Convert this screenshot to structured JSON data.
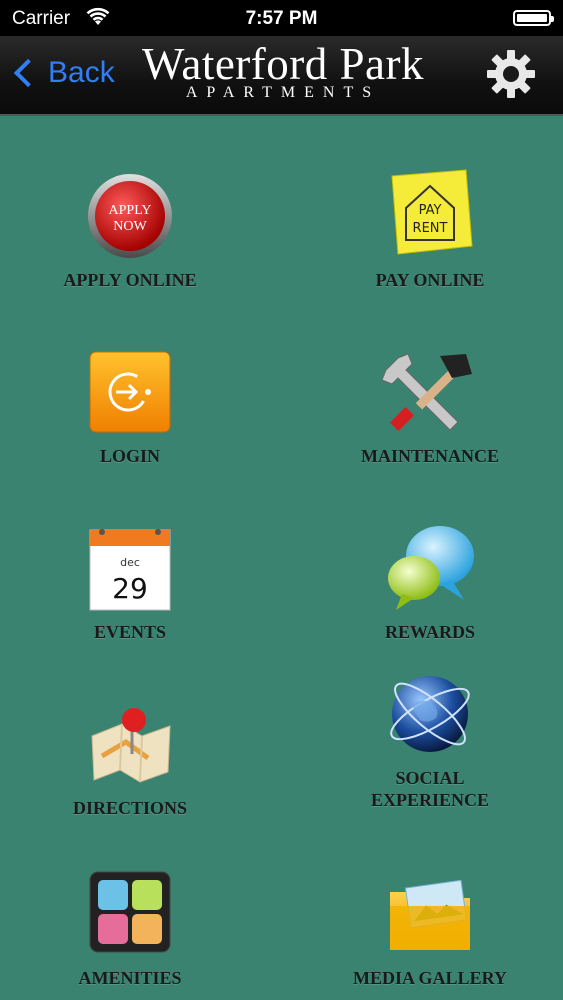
{
  "status": {
    "carrier": "Carrier",
    "time": "7:57 PM"
  },
  "nav": {
    "back_label": "Back",
    "logo_name": "Waterford Park",
    "logo_sub": "APARTMENTS"
  },
  "tiles": [
    {
      "label": "APPLY ONLINE",
      "icon": "apply-now-icon",
      "icon_text_1": "APPLY",
      "icon_text_2": "NOW"
    },
    {
      "label": "PAY ONLINE",
      "icon": "pay-rent-note-icon",
      "icon_text_1": "PAY",
      "icon_text_2": "RENT"
    },
    {
      "label": "LOGIN",
      "icon": "login-arrow-icon"
    },
    {
      "label": "MAINTENANCE",
      "icon": "tools-icon"
    },
    {
      "label": "EVENTS",
      "icon": "calendar-icon",
      "icon_text_1": "dec",
      "icon_text_2": "29"
    },
    {
      "label": "REWARDS",
      "icon": "chat-bubbles-icon"
    },
    {
      "label": "DIRECTIONS",
      "icon": "map-pin-icon"
    },
    {
      "label": "SOCIAL EXPERIENCE",
      "icon": "globe-icon"
    },
    {
      "label": "AMENITIES",
      "icon": "amenities-grid-icon"
    },
    {
      "label": "MEDIA GALLERY",
      "icon": "photo-folder-icon"
    }
  ],
  "colors": {
    "background": "#3a8370",
    "back_blue": "#2f7ff5",
    "label": "#1a1a1a"
  }
}
